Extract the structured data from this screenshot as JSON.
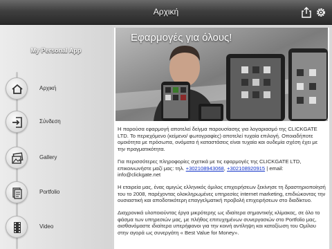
{
  "header": {
    "title": "Αρχική",
    "share_icon": "share-icon",
    "settings_icon": "gear-icon"
  },
  "sidebar": {
    "app_title": "My Personal App",
    "items": [
      {
        "label": "Αρχική",
        "icon": "home-icon"
      },
      {
        "label": "Σύνδεση",
        "icon": "login-icon"
      },
      {
        "label": "Gallery",
        "icon": "gallery-icon"
      },
      {
        "label": "Portfolio",
        "icon": "portfolio-icon"
      },
      {
        "label": "Video",
        "icon": "film-icon"
      }
    ]
  },
  "banner": {
    "tagline": "Εφαρμογές για όλους!"
  },
  "content": {
    "p1": "Η παρούσα εφαρμογή αποτελεί δείγμα παρουσίασης για λογαριασμό της CLICKGATE LTD. Το περιεχόμενο (κείμενο/ φωτογραφίες) αποτελεί τυχαία επιλογή. Οποιαδήποτε ομοιότητα με πρόσωπα, ονόματα ή καταστάσεις είναι τυχαία και ουδεμία σχέση έχει με την πραγματικότητα.",
    "p2_text": "Για περισσότερες πληροφορίες σχετικά με τις εφαρμογές της CLICKGATE LTD, επικοινωνήστε μαζί μας: τηλ. ",
    "phone1": "+302108943068",
    "sep": ", ",
    "phone2": "+302108920915",
    "p2_email_prefix": " | email: ",
    "email": "info@clickgate.net",
    "p3": "Η εταιρεία μας, ένας αμιγώς ελληνικός όμιλος επιχειρήσεων ξεκίνησε τη δραστηριοποίησή του το 2008, παρέχοντας ολοκληρωμένες υπηρεσίες internet marketing, επιδιώκοντας την ουσιαστική και αποδοτικότερη επαγγελματική προβολή επιχειρήσεων στο διαδίκτυο.",
    "p4": "Διαχρονικά υλοποιούντας έργα μικρότερης ως ιδιαίτερα σημαντικής κλίμακας, σε όλο το φάσμα των υπηρεσιών μας, με πλήθος επιτυχημένων συνεργασιών στο Portfolio μας, αισθανόμαστε ιδιαίτερα υπερήφανοι για την κοινή αντίληψη και καταξίωση του Ομίλου στην αγορά ως συνεργάτη « Best Value for Money»."
  }
}
